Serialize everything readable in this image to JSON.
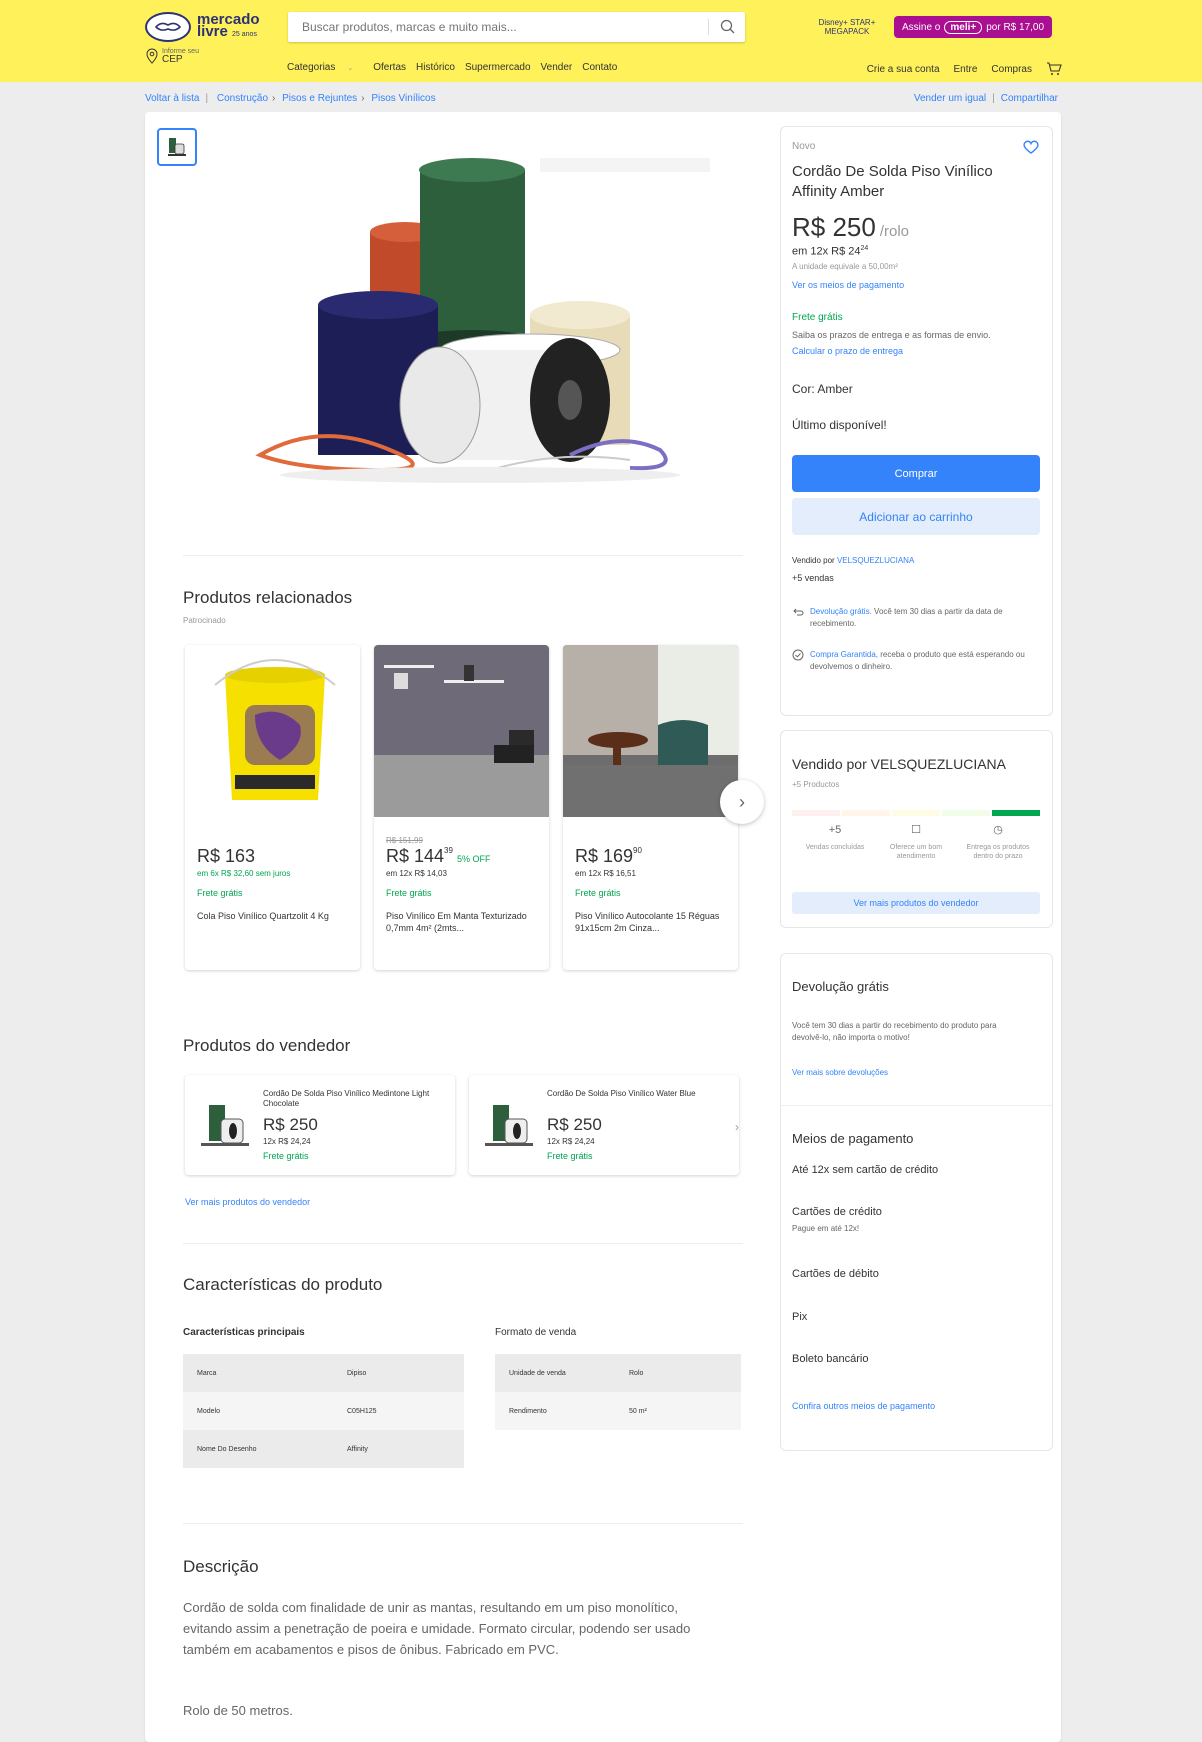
{
  "header": {
    "logo_text": "mercado",
    "logo_text2": "livre",
    "logo_sub": "25 anos",
    "search_placeholder": "Buscar produtos, marcas e muito mais...",
    "promo_logos": "Disney+ STAR+ MEGAPACK",
    "promo_prefix": "Assine o",
    "promo_meli": "meli+",
    "promo_suffix": "por R$ 17,00",
    "cep_label": "Informe seu",
    "cep_value": "CEP",
    "nav": [
      "Categorias",
      "Ofertas",
      "Histórico",
      "Supermercado",
      "Vender",
      "Contato"
    ],
    "account": [
      "Crie a sua conta",
      "Entre",
      "Compras"
    ]
  },
  "breadcrumb": {
    "back": "Voltar à lista",
    "items": [
      "Construção",
      "Pisos e Rejuntes",
      "Pisos Vinílicos"
    ],
    "sell_same": "Vender um igual",
    "share": "Compartilhar"
  },
  "related": {
    "title": "Produtos relacionados",
    "sponsored": "Patrocinado",
    "items": [
      {
        "old": "",
        "price": "R$ 163",
        "cents": "",
        "off": "",
        "installments": "em 6x R$ 32,60 sem juros",
        "free": "Frete grátis",
        "title": "Cola Piso Vinílico Quartzolit 4 Kg"
      },
      {
        "old": "R$ 151,99",
        "price": "R$ 144",
        "cents": "39",
        "off": "5% OFF",
        "installments": "em 12x R$ 14,03",
        "free": "Frete grátis",
        "title": "Piso Vinílico Em Manta Texturizado 0,7mm 4m² (2mts..."
      },
      {
        "old": "",
        "price": "R$ 169",
        "cents": "90",
        "off": "",
        "installments": "em 12x R$ 16,51",
        "free": "Frete grátis",
        "title": "Piso Vinílico Autocolante 15 Réguas 91x15cm 2m Cinza..."
      }
    ]
  },
  "seller_products": {
    "title": "Produtos do vendedor",
    "items": [
      {
        "title": "Cordão De Solda Piso Vinílico Medintone Light Chocolate",
        "price": "R$ 250",
        "installments": "12x R$ 24,24",
        "free": "Frete grátis"
      },
      {
        "title": "Cordão De Solda Piso Vinílico Water Blue",
        "price": "R$ 250",
        "installments": "12x R$ 24,24",
        "free": "Frete grátis"
      }
    ],
    "more": "Ver mais produtos do vendedor"
  },
  "specs": {
    "title": "Características do produto",
    "main_title": "Características principais",
    "main_rows": [
      [
        "Marca",
        "Dipiso"
      ],
      [
        "Modelo",
        "C05H125"
      ],
      [
        "Nome Do Desenho",
        "Affinity"
      ]
    ],
    "sale_title": "Formato de venda",
    "sale_rows": [
      [
        "Unidade de venda",
        "Rolo"
      ],
      [
        "Rendimento",
        "50 m²"
      ]
    ]
  },
  "description": {
    "title": "Descrição",
    "text": "Cordão de solda com finalidade de unir as mantas, resultando em um piso monolítico, evitando assim a penetração de poeira e umidade. Formato circular, podendo ser usado também em acabamentos e pisos de ônibus. Fabricado em PVC.",
    "text2": "Rolo de 50 metros."
  },
  "buybox": {
    "condition": "Novo",
    "title": "Cordão De Solda Piso Vinílico Affinity Amber",
    "price": "R$ 250",
    "price_unit": "/rolo",
    "installments": "em 12x R$ 24",
    "installments_cents": "24",
    "unit_equiv": "A unidade equivale a 50,00m²",
    "payment_link": "Ver os meios de pagamento",
    "shipping": "Frete grátis",
    "shipping_info": "Saiba os prazos de entrega e as formas de envio.",
    "shipping_link": "Calcular o prazo de entrega",
    "color": "Cor: Amber",
    "stock": "Último disponível!",
    "buy": "Comprar",
    "add_cart": "Adicionar ao carrinho",
    "sold_by_label": "Vendido por",
    "sold_by": "VELSQUEZLUCIANA",
    "sales": "+5 vendas",
    "return_link": "Devolução grátis.",
    "return_text": "Você tem 30 dias a partir da data de recebimento.",
    "guarantee_link": "Compra Garantida,",
    "guarantee_text": "receba o produto que está esperando ou devolvemos o dinheiro."
  },
  "seller": {
    "title": "Vendido por VELSQUEZLUCIANA",
    "products": "+5 Productos",
    "stats": [
      {
        "icon": "+5",
        "label": "Vendas concluídas"
      },
      {
        "icon": "chat-icon",
        "label": "Oferece um bom atendimento"
      },
      {
        "icon": "clock-icon",
        "label": "Entrega os produtos dentro do prazo"
      }
    ],
    "more": "Ver mais produtos do vendedor",
    "reputation_colors": [
      "#fff0f0",
      "#fff5e8",
      "#fffce6",
      "#f1fde7",
      "#00a650"
    ]
  },
  "returns": {
    "title": "Devolução grátis",
    "text": "Você tem 30 dias a partir do recebimento do produto para devolvê-lo, não importa o motivo!",
    "link": "Ver mais sobre devoluções"
  },
  "payments": {
    "title": "Meios de pagamento",
    "installments": "Até 12x sem cartão de crédito",
    "credit": "Cartões de crédito",
    "credit_sub": "Pague em até 12x!",
    "debit": "Cartões de débito",
    "pix": "Pix",
    "boleto": "Boleto bancário",
    "link": "Confira outros meios de pagamento"
  },
  "colors": {
    "brand_yellow": "#fff159",
    "accent_blue": "#3483fa",
    "green": "#00a650",
    "meli_purple": "#a90f90"
  }
}
